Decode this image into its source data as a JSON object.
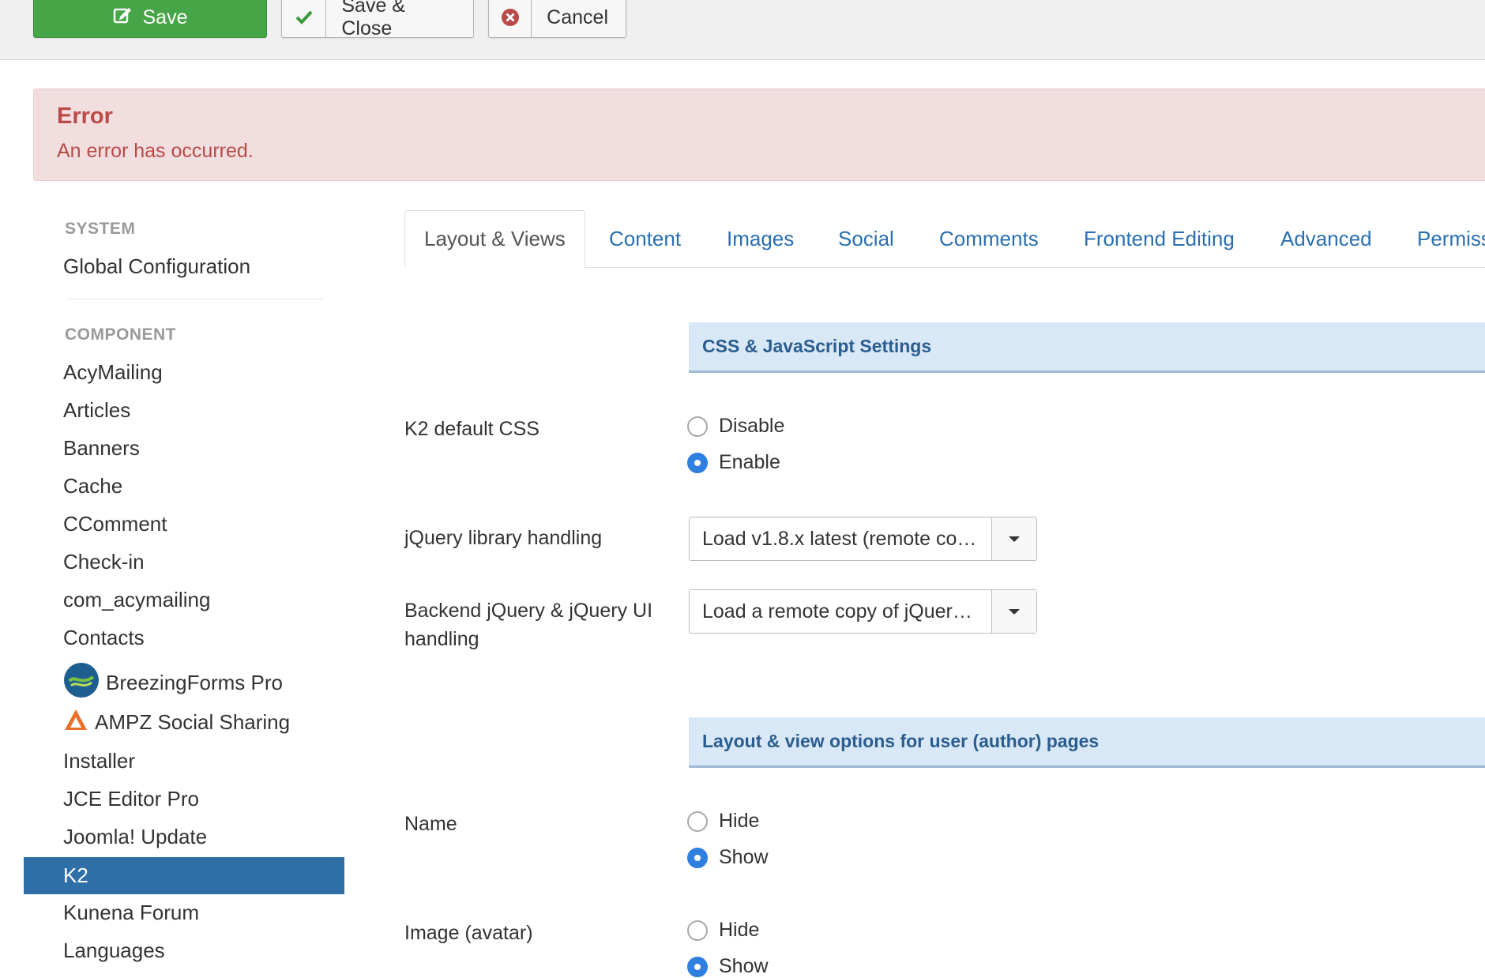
{
  "toolbar": {
    "save_label": "Save",
    "save_close_label": "Save & Close",
    "cancel_label": "Cancel",
    "colors": {
      "save_bg": "#46a546",
      "check": "#3c9a3c",
      "cancel_icon": "#b94a48"
    }
  },
  "alert": {
    "heading": "Error",
    "message": "An error has occurred."
  },
  "sidebar": {
    "system_header": "SYSTEM",
    "system_items": [
      {
        "label": "Global Configuration"
      }
    ],
    "component_header": "COMPONENT",
    "component_items": [
      {
        "label": "AcyMailing"
      },
      {
        "label": "Articles"
      },
      {
        "label": "Banners"
      },
      {
        "label": "Cache"
      },
      {
        "label": "CComment"
      },
      {
        "label": "Check-in"
      },
      {
        "label": "com_acymailing"
      },
      {
        "label": "Contacts"
      },
      {
        "label": "BreezingForms Pro",
        "icon": "breezingforms-logo-icon"
      },
      {
        "label": "AMPZ Social Sharing",
        "icon": "ampz-logo-icon"
      },
      {
        "label": "Installer"
      },
      {
        "label": "JCE Editor Pro"
      },
      {
        "label": "Joomla! Update"
      },
      {
        "label": "K2",
        "active": true
      },
      {
        "label": "Kunena Forum"
      },
      {
        "label": "Languages"
      }
    ],
    "active_color": "#2f6fa8"
  },
  "tabs": [
    {
      "label": "Layout & Views",
      "active": true
    },
    {
      "label": "Content"
    },
    {
      "label": "Images"
    },
    {
      "label": "Social"
    },
    {
      "label": "Comments"
    },
    {
      "label": "Frontend Editing"
    },
    {
      "label": "Advanced"
    },
    {
      "label": "Permiss"
    }
  ],
  "sections": {
    "css_js": "CSS & JavaScript Settings",
    "user_pages": "Layout & view options for user (author) pages"
  },
  "fields": {
    "k2_default_css": {
      "label": "K2 default CSS",
      "options": [
        "Disable",
        "Enable"
      ],
      "selected": "Enable"
    },
    "jquery_handling": {
      "label": "jQuery library handling",
      "value": "Load v1.8.x latest (remote co…"
    },
    "backend_jquery": {
      "label": "Backend jQuery & jQuery UI handling",
      "value": "Load a remote copy of jQuer…"
    },
    "name": {
      "label": "Name",
      "options": [
        "Hide",
        "Show"
      ],
      "selected": "Show"
    },
    "image_avatar": {
      "label": "Image (avatar)",
      "options": [
        "Hide",
        "Show"
      ],
      "selected": "Show"
    }
  }
}
